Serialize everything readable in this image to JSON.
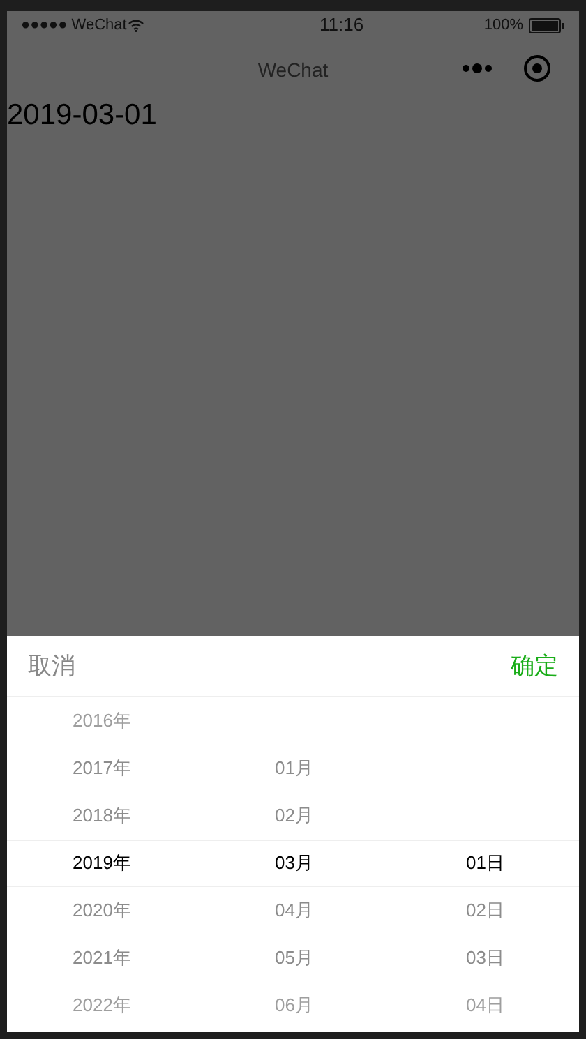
{
  "status_bar": {
    "signal": "●●●●● WeChat",
    "time": "11:16",
    "battery": "100%"
  },
  "nav_bar": {
    "title": "WeChat"
  },
  "page": {
    "date_text": "2019-03-01"
  },
  "picker": {
    "cancel": "取消",
    "confirm": "确定",
    "columns": [
      {
        "items": [
          {
            "label": "2016年",
            "selected": false
          },
          {
            "label": "2017年",
            "selected": false
          },
          {
            "label": "2018年",
            "selected": false
          },
          {
            "label": "2019年",
            "selected": true
          },
          {
            "label": "2020年",
            "selected": false
          },
          {
            "label": "2021年",
            "selected": false
          },
          {
            "label": "2022年",
            "selected": false
          }
        ]
      },
      {
        "items": [
          {
            "label": "01月",
            "selected": false
          },
          {
            "label": "02月",
            "selected": false
          },
          {
            "label": "03月",
            "selected": true
          },
          {
            "label": "04月",
            "selected": false
          },
          {
            "label": "05月",
            "selected": false
          },
          {
            "label": "06月",
            "selected": false
          }
        ]
      },
      {
        "items": [
          {
            "label": "01日",
            "selected": true
          },
          {
            "label": "02日",
            "selected": false
          },
          {
            "label": "03日",
            "selected": false
          },
          {
            "label": "04日",
            "selected": false
          }
        ]
      }
    ]
  }
}
